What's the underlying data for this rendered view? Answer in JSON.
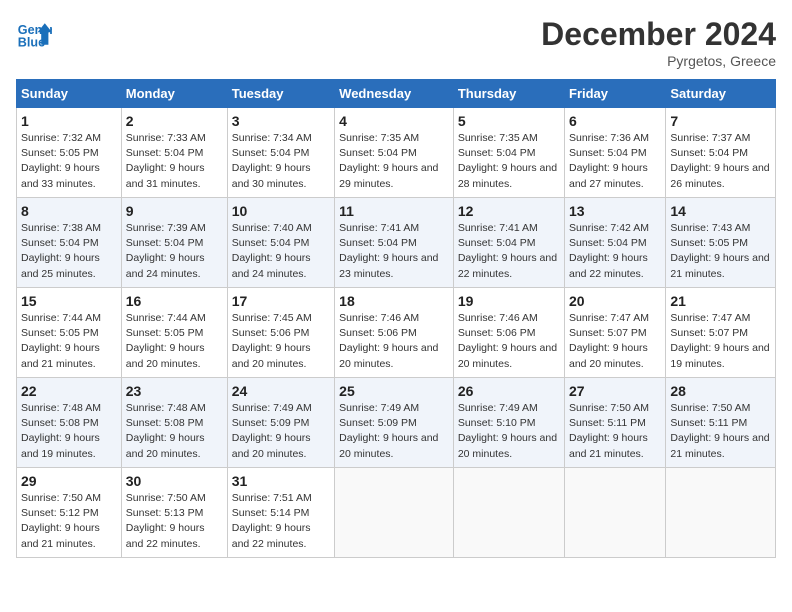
{
  "header": {
    "logo_line1": "General",
    "logo_line2": "Blue",
    "month": "December 2024",
    "location": "Pyrgetos, Greece"
  },
  "weekdays": [
    "Sunday",
    "Monday",
    "Tuesday",
    "Wednesday",
    "Thursday",
    "Friday",
    "Saturday"
  ],
  "weeks": [
    [
      {
        "day": "1",
        "sunrise": "7:32 AM",
        "sunset": "5:05 PM",
        "daylight": "9 hours and 33 minutes."
      },
      {
        "day": "2",
        "sunrise": "7:33 AM",
        "sunset": "5:04 PM",
        "daylight": "9 hours and 31 minutes."
      },
      {
        "day": "3",
        "sunrise": "7:34 AM",
        "sunset": "5:04 PM",
        "daylight": "9 hours and 30 minutes."
      },
      {
        "day": "4",
        "sunrise": "7:35 AM",
        "sunset": "5:04 PM",
        "daylight": "9 hours and 29 minutes."
      },
      {
        "day": "5",
        "sunrise": "7:35 AM",
        "sunset": "5:04 PM",
        "daylight": "9 hours and 28 minutes."
      },
      {
        "day": "6",
        "sunrise": "7:36 AM",
        "sunset": "5:04 PM",
        "daylight": "9 hours and 27 minutes."
      },
      {
        "day": "7",
        "sunrise": "7:37 AM",
        "sunset": "5:04 PM",
        "daylight": "9 hours and 26 minutes."
      }
    ],
    [
      {
        "day": "8",
        "sunrise": "7:38 AM",
        "sunset": "5:04 PM",
        "daylight": "9 hours and 25 minutes."
      },
      {
        "day": "9",
        "sunrise": "7:39 AM",
        "sunset": "5:04 PM",
        "daylight": "9 hours and 24 minutes."
      },
      {
        "day": "10",
        "sunrise": "7:40 AM",
        "sunset": "5:04 PM",
        "daylight": "9 hours and 24 minutes."
      },
      {
        "day": "11",
        "sunrise": "7:41 AM",
        "sunset": "5:04 PM",
        "daylight": "9 hours and 23 minutes."
      },
      {
        "day": "12",
        "sunrise": "7:41 AM",
        "sunset": "5:04 PM",
        "daylight": "9 hours and 22 minutes."
      },
      {
        "day": "13",
        "sunrise": "7:42 AM",
        "sunset": "5:04 PM",
        "daylight": "9 hours and 22 minutes."
      },
      {
        "day": "14",
        "sunrise": "7:43 AM",
        "sunset": "5:05 PM",
        "daylight": "9 hours and 21 minutes."
      }
    ],
    [
      {
        "day": "15",
        "sunrise": "7:44 AM",
        "sunset": "5:05 PM",
        "daylight": "9 hours and 21 minutes."
      },
      {
        "day": "16",
        "sunrise": "7:44 AM",
        "sunset": "5:05 PM",
        "daylight": "9 hours and 20 minutes."
      },
      {
        "day": "17",
        "sunrise": "7:45 AM",
        "sunset": "5:06 PM",
        "daylight": "9 hours and 20 minutes."
      },
      {
        "day": "18",
        "sunrise": "7:46 AM",
        "sunset": "5:06 PM",
        "daylight": "9 hours and 20 minutes."
      },
      {
        "day": "19",
        "sunrise": "7:46 AM",
        "sunset": "5:06 PM",
        "daylight": "9 hours and 20 minutes."
      },
      {
        "day": "20",
        "sunrise": "7:47 AM",
        "sunset": "5:07 PM",
        "daylight": "9 hours and 20 minutes."
      },
      {
        "day": "21",
        "sunrise": "7:47 AM",
        "sunset": "5:07 PM",
        "daylight": "9 hours and 19 minutes."
      }
    ],
    [
      {
        "day": "22",
        "sunrise": "7:48 AM",
        "sunset": "5:08 PM",
        "daylight": "9 hours and 19 minutes."
      },
      {
        "day": "23",
        "sunrise": "7:48 AM",
        "sunset": "5:08 PM",
        "daylight": "9 hours and 20 minutes."
      },
      {
        "day": "24",
        "sunrise": "7:49 AM",
        "sunset": "5:09 PM",
        "daylight": "9 hours and 20 minutes."
      },
      {
        "day": "25",
        "sunrise": "7:49 AM",
        "sunset": "5:09 PM",
        "daylight": "9 hours and 20 minutes."
      },
      {
        "day": "26",
        "sunrise": "7:49 AM",
        "sunset": "5:10 PM",
        "daylight": "9 hours and 20 minutes."
      },
      {
        "day": "27",
        "sunrise": "7:50 AM",
        "sunset": "5:11 PM",
        "daylight": "9 hours and 21 minutes."
      },
      {
        "day": "28",
        "sunrise": "7:50 AM",
        "sunset": "5:11 PM",
        "daylight": "9 hours and 21 minutes."
      }
    ],
    [
      {
        "day": "29",
        "sunrise": "7:50 AM",
        "sunset": "5:12 PM",
        "daylight": "9 hours and 21 minutes."
      },
      {
        "day": "30",
        "sunrise": "7:50 AM",
        "sunset": "5:13 PM",
        "daylight": "9 hours and 22 minutes."
      },
      {
        "day": "31",
        "sunrise": "7:51 AM",
        "sunset": "5:14 PM",
        "daylight": "9 hours and 22 minutes."
      },
      null,
      null,
      null,
      null
    ]
  ],
  "labels": {
    "sunrise": "Sunrise:",
    "sunset": "Sunset:",
    "daylight": "Daylight:"
  }
}
